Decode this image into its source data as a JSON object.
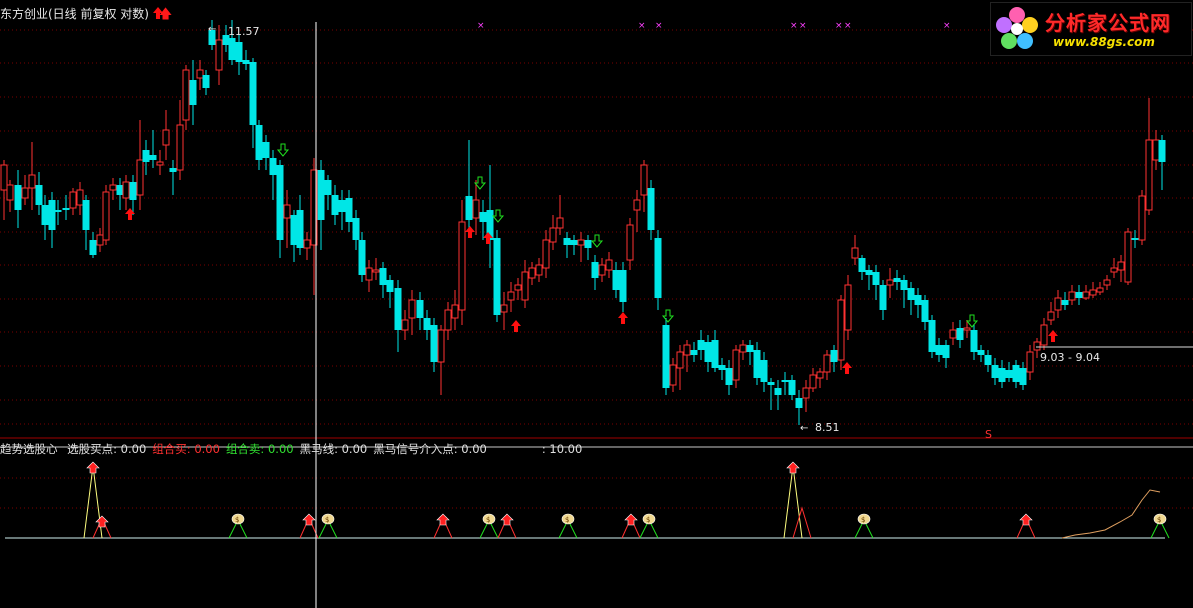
{
  "header": {
    "title": "东方创业(日线 前复权 对数)",
    "arrow_icon": "red-up-arrow-icon"
  },
  "annotations": {
    "high_label": "11.57",
    "low_label": "8.51",
    "range_label": "9.03 - 9.04",
    "signal_s": "S"
  },
  "logo": {
    "title": "分析家公式网",
    "url": "www.88gs.com"
  },
  "indicator_header": {
    "name": "趋势选股心",
    "items": [
      {
        "label": "选股买点:",
        "value": "0.00",
        "color": "#e0e0e0"
      },
      {
        "label": "组合买:",
        "value": "0.00",
        "color": "#ff3030"
      },
      {
        "label": "组合卖:",
        "value": "0.00",
        "color": "#30e030"
      },
      {
        "label": "黑马线:",
        "value": "0.00",
        "color": "#e0e0e0"
      },
      {
        "label": "黑马信号介入点:",
        "value": "0.00",
        "color": "#e0e0e0"
      },
      {
        "label": ":",
        "value": "10.00",
        "color": "#e0e0e0"
      }
    ]
  },
  "colors": {
    "up": "#ff3232",
    "down": "#00e6e6",
    "grid": "#7a0000",
    "crosshair": "#ffffff",
    "buy_arrow": "#ff1010",
    "sell_arrow": "#20e020",
    "marker": "#ff40ff",
    "money_bag": "#f0d890",
    "signal_line": "#ffff80",
    "heima_line": "#e0a060"
  }
}
